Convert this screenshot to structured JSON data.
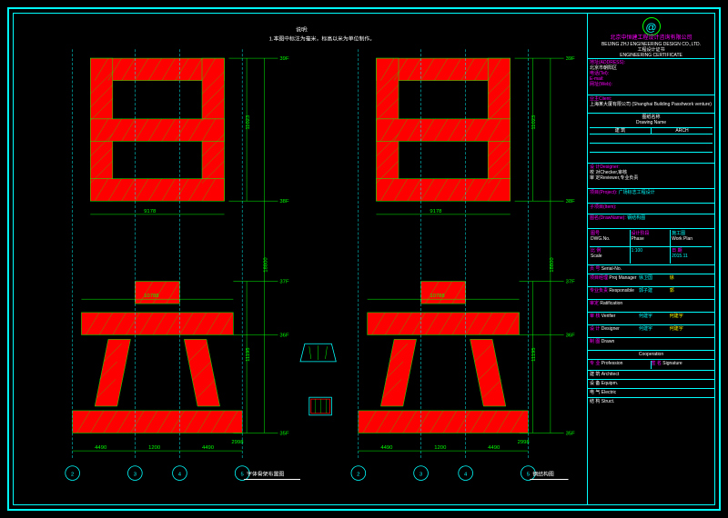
{
  "note_header": "说明:",
  "note_text": "1.本图中标注为毫米，标高以米为单位制作。",
  "elevations": {
    "ri_top_level": "39F",
    "ri_bot_level": "38F",
    "ri_height": "11023",
    "ri_width": "9178",
    "gap_height": "18800",
    "li_top_level": "37F",
    "li_width_top": "10788",
    "li_height": "11195",
    "li_mid_level": "36F",
    "li_bot_level": "35F",
    "dim_4490_l": "4490",
    "dim_4490_r": "4490",
    "dim_1200": "1200",
    "dim_2998": "2998"
  },
  "grid": {
    "g2": "2",
    "g3": "3",
    "g4": "4",
    "g5": "5"
  },
  "titles": {
    "left_title": "字体骨架布置图",
    "right_title": "钢结构图"
  },
  "titleblock": {
    "company_cn": "北京中恒建工程设计咨询有限公司",
    "company_en": "BEIJING ZHJ ENGINEERING DESIGN CO.,LTD.",
    "reg_no": "工程设计证书",
    "cert": "ENGINEERING CERTIFICATE",
    "addr_label": "地址(ADDRESS):",
    "addr": "北京市朝阳区",
    "tel_label": "电话(Tel):",
    "email_label": "E-mail:",
    "web_label": "网址(Web):",
    "client_label": "业主Client:",
    "client": "上海某大厦有限公司 (Shanghai Building Passhwork venture)",
    "stamp_label": "图纸名称",
    "stamp_label_en": "Drawing Name",
    "arch_label": "建 筑",
    "arch_en": "ARCH",
    "designer_label": "设 计Designer:",
    "checker_label": "校 对Checker,审核",
    "reviewer_label": "审 定Reviewer,专业负责",
    "project_label": "项目(Project):",
    "project": "广场标志工程设计",
    "item_label": "子项目(Item):",
    "drawing_label": "图名(DrawName):",
    "drawing": "钢结构图",
    "dwg_no_label": "图号",
    "dwg_no_en": "DWG.No.",
    "phase_label": "设计阶段",
    "phase_en": "Phase",
    "phase": "施工图",
    "phase_en2": "Work Plan",
    "scale_label": "比 例",
    "scale_en": "Scale",
    "scale": "1:100",
    "date_label": "日 期",
    "date_en": "Date",
    "date": "2015.11",
    "serial_label": "页 号",
    "serial_en": "Serial-No.",
    "sig_pm": "项目经理",
    "sig_pm_en": "Proj Manager",
    "sig_pm_val": "徐卫国",
    "sig_resp": "专业负责",
    "sig_resp_en": "Responsible",
    "sig_resp_val": "郭子建",
    "sig_check": "审定",
    "sig_check_en": "Ratification",
    "sig_rev": "审 核",
    "sig_rev_en": "Verifier",
    "sig_rev_val": "何建宇",
    "sig_des": "设 计",
    "sig_des_en": "Designer",
    "sig_des_val": "何建宇",
    "sig_draw": "制 图",
    "sig_draw_en": "Drawn",
    "coop_label": "Cooperation",
    "coop_prof1": "专 业",
    "coop_prof1_en": "Profession",
    "coop_prof2": "签 名",
    "coop_prof2_en": "Signature",
    "coop_row1": "建 筑 Architect",
    "coop_row2": "设 备 Equipm.",
    "coop_row3": "电 气 Electric",
    "coop_row4": "结 构 Struct."
  }
}
